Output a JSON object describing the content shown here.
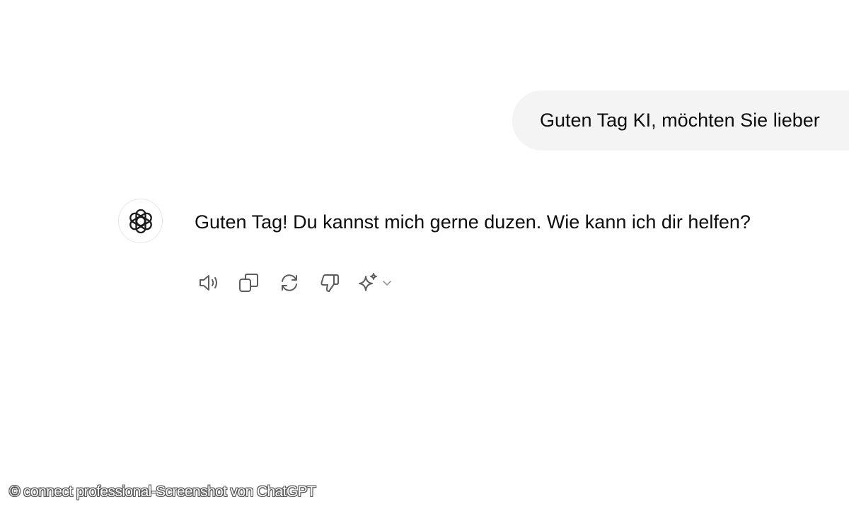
{
  "conversation": {
    "user_message": "Guten Tag KI, möchten Sie lieber",
    "assistant_message": "Guten Tag! Du kannst mich gerne duzen. Wie kann ich dir helfen?"
  },
  "actions": [
    {
      "name": "read-aloud",
      "icon": "speaker-icon"
    },
    {
      "name": "copy",
      "icon": "copy-icon"
    },
    {
      "name": "regenerate",
      "icon": "refresh-icon"
    },
    {
      "name": "bad-response",
      "icon": "thumbs-down-icon"
    },
    {
      "name": "model-switch",
      "icon": "sparkle-icon"
    }
  ],
  "icons": {
    "assistant_avatar": "openai-logo-icon"
  },
  "colors": {
    "user_bubble": "#f4f4f4",
    "text": "#0d0d0d",
    "icon": "#5d5d5d"
  },
  "watermark": "© connect professional-Screenshot von ChatGPT"
}
